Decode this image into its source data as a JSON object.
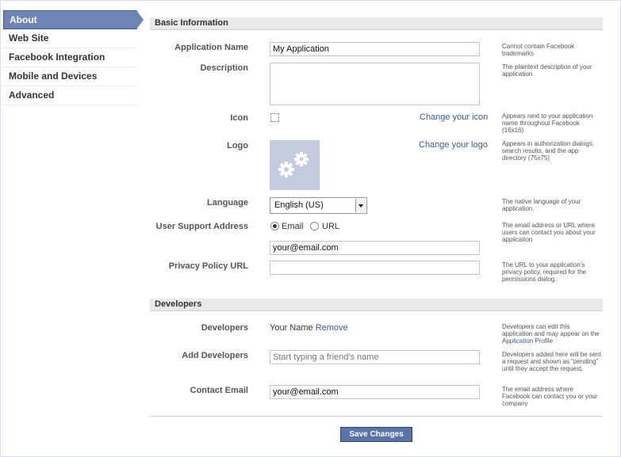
{
  "sidebar": {
    "items": [
      {
        "label": "About",
        "active": true
      },
      {
        "label": "Web Site"
      },
      {
        "label": "Facebook Integration"
      },
      {
        "label": "Mobile and Devices"
      },
      {
        "label": "Advanced"
      }
    ]
  },
  "basic": {
    "header": "Basic Information",
    "app_name_label": "Application Name",
    "app_name_value": "My Application",
    "app_name_hint": "Cannot contain Facebook trademarks",
    "description_label": "Description",
    "description_value": "",
    "description_hint": "The plaintext description of your application",
    "icon_label": "Icon",
    "icon_link": "Change your icon",
    "icon_hint": "Appears next to your application name throughout Facebook (16x16)",
    "logo_label": "Logo",
    "logo_link": "Change your logo",
    "logo_hint": "Appears in authorization dialogs, search results, and the app directory (75x75)",
    "language_label": "Language",
    "language_value": "English (US)",
    "language_hint": "The native language of your application.",
    "support_label": "User Support Address",
    "support_email_option": "Email",
    "support_url_option": "URL",
    "support_value": "your@email.com",
    "support_hint": "The email address or URL where users can contact you about your application",
    "privacy_label": "Privacy Policy URL",
    "privacy_value": "",
    "privacy_hint": "The URL to your application's privacy policy, required for the permissions dialog."
  },
  "developers": {
    "header": "Developers",
    "developers_label": "Developers",
    "developer_name": "Your Name",
    "remove_link": "Remove",
    "developers_hint": "Developers can edit this application and may appear on the",
    "developers_hint_link": "Application Profile",
    "add_label": "Add Developers",
    "add_placeholder": "Start typing a friend's name",
    "add_hint": "Developers added here will be sent a request and shown as \"pending\" until they accept the request.",
    "contact_label": "Contact Email",
    "contact_value": "your@email.com",
    "contact_hint": "The email address where Facebook can contact you or your company"
  },
  "save_label": "Save Changes",
  "icons": {
    "logo_placeholder": "gears-icon",
    "language_select": "chevron-down-icon"
  },
  "colors": {
    "accent": "#3b5998",
    "sidebar_active": "#6d84b4",
    "button": "#5b74a8"
  }
}
